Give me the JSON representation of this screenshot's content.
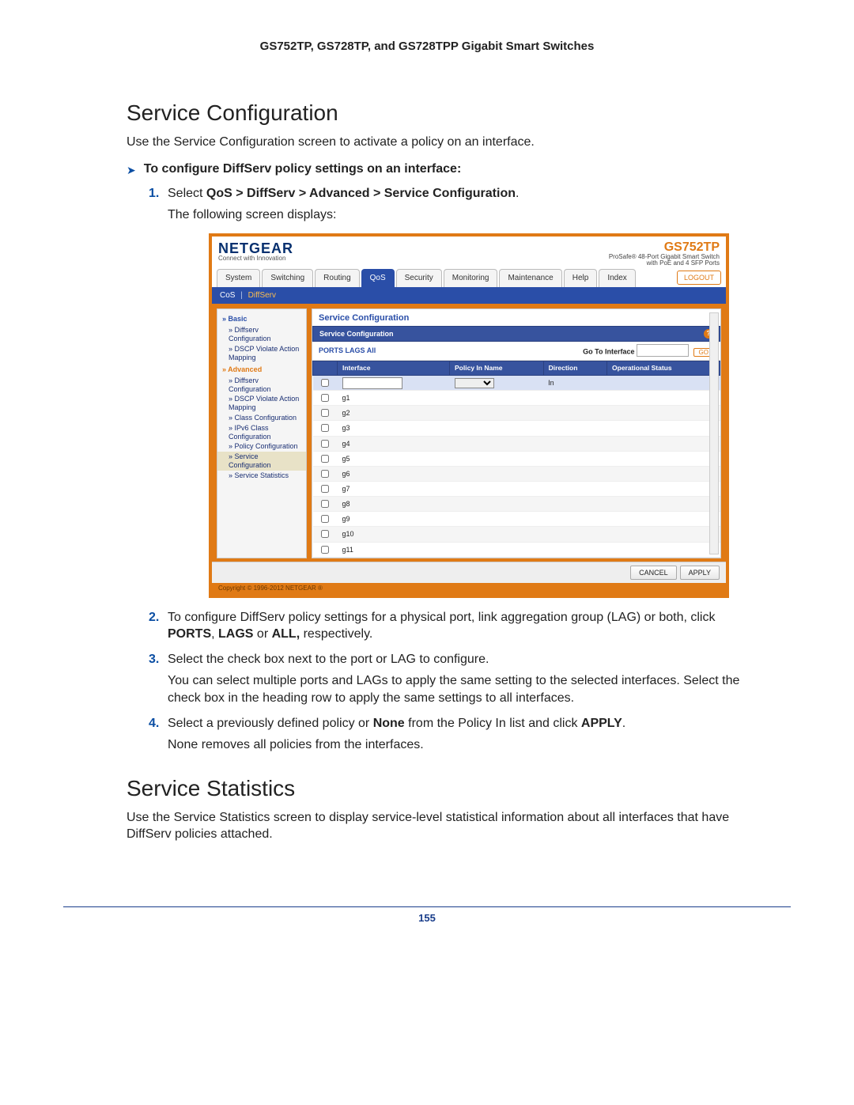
{
  "doc_header": "GS752TP, GS728TP, and GS728TPP Gigabit Smart Switches",
  "section1_title": "Service Configuration",
  "section1_p1": "Use the Service Configuration screen to activate a policy on an interface.",
  "tri1": "To configure DiffServ policy settings on an interface:",
  "step1_prefix": "Select ",
  "step1_path": "QoS > DiffServ > Advanced > Service Configuration",
  "step1_suffix": ".",
  "step1_after": "The following screen displays:",
  "step2a": "To configure DiffServ policy settings for a physical port, link aggregation group (LAG) or both, click ",
  "step2b_ports": "PORTS",
  "step2b_lags": "LAGS",
  "step2b_all": "ALL,",
  "step2c": " respectively.",
  "step3a": "Select the check box next to the port or LAG to configure.",
  "step3b": "You can select multiple ports and LAGs to apply the same setting to the selected interfaces. Select the check box in the heading row to apply the same settings to all interfaces.",
  "step4a": "Select a previously defined policy or ",
  "step4a_none": "None",
  "step4a2": " from the Policy In list and click ",
  "step4a_apply": "APPLY",
  "step4a3": ".",
  "step4b": "None removes all policies from the interfaces.",
  "section2_title": "Service Statistics",
  "section2_p1": "Use the Service Statistics screen to display service-level statistical information about all interfaces that have DiffServ policies attached.",
  "page_number": "155",
  "screenshot": {
    "logo": "NETGEAR",
    "logo_sub": "Connect with Innovation",
    "model": "GS752TP",
    "model_desc1": "ProSafe® 48-Port Gigabit Smart Switch",
    "model_desc2": "with PoE and 4 SFP Ports",
    "tabs": [
      "System",
      "Switching",
      "Routing",
      "QoS",
      "Security",
      "Monitoring",
      "Maintenance",
      "Help",
      "Index"
    ],
    "active_tab": "QoS",
    "logout": "LOGOUT",
    "subnav1": "CoS",
    "subnav2": "DiffServ",
    "side": {
      "basic": "Basic",
      "basic_items": [
        "Diffserv Configuration",
        "DSCP Violate Action Mapping"
      ],
      "advanced": "Advanced",
      "advanced_items": [
        "Diffserv Configuration",
        "DSCP Violate Action Mapping",
        "Class Configuration",
        "IPv6 Class Configuration",
        "Policy Configuration",
        "Service Configuration",
        "Service Statistics"
      ],
      "selected": "Service Configuration"
    },
    "panel_title": "Service Configuration",
    "panel_head": "Service Configuration",
    "filter": {
      "ports": "PORTS",
      "lags": "LAGS",
      "all": "All",
      "goto": "Go To Interface",
      "go": "GO"
    },
    "columns": [
      "",
      "Interface",
      "Policy In Name",
      "Direction",
      "Operational Status"
    ],
    "input_row_direction": "In",
    "rows": [
      "g1",
      "g2",
      "g3",
      "g4",
      "g5",
      "g6",
      "g7",
      "g8",
      "g9",
      "g10",
      "g11"
    ],
    "cancel": "CANCEL",
    "apply": "APPLY",
    "copyright": "Copyright © 1996-2012 NETGEAR ®"
  }
}
